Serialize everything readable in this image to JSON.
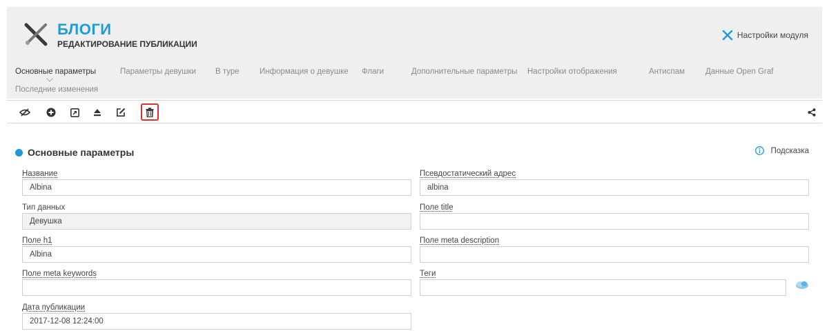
{
  "header": {
    "title": "БЛОГИ",
    "subtitle": "РЕДАКТИРОВАНИЕ ПУБЛИКАЦИИ",
    "settings_label": "Настройки модуля",
    "accent_color": "#1e9bd7"
  },
  "tabs": [
    {
      "label": "Основные параметры",
      "active": true
    },
    {
      "label": "Параметры девушки"
    },
    {
      "label": "В туре"
    },
    {
      "label": "Информация о девушке"
    },
    {
      "label": "Флаги"
    },
    {
      "label": "Дополнительные параметры"
    },
    {
      "label": "Настройки отображения"
    },
    {
      "label": "Антиспам"
    },
    {
      "label": "Данные Open Graf"
    },
    {
      "label": "Последние изменения"
    }
  ],
  "toolbar": {
    "icons": [
      "hide-icon",
      "add-icon",
      "open-external-icon",
      "eject-icon",
      "edit-icon",
      "delete-icon",
      "share-icon"
    ],
    "highlight_color": "#d9302c"
  },
  "section": {
    "title": "Основные параметры",
    "hint_label": "Подсказка"
  },
  "fields": {
    "name": {
      "label": "Название",
      "value": "Albina"
    },
    "alias": {
      "label": "Псевдостатический адрес",
      "value": "albina"
    },
    "data_type": {
      "label": "Тип данных",
      "value": "Девушка"
    },
    "title_field": {
      "label": "Поле title",
      "value": ""
    },
    "h1": {
      "label": "Поле h1",
      "value": "Albina"
    },
    "meta_description": {
      "label": "Поле meta description",
      "value": ""
    },
    "meta_keywords": {
      "label": "Поле meta keywords",
      "value": ""
    },
    "tags": {
      "label": "Теги",
      "value": ""
    },
    "pub_date": {
      "label": "Дата публикации",
      "value": "2017-12-08 12:24:00"
    }
  }
}
